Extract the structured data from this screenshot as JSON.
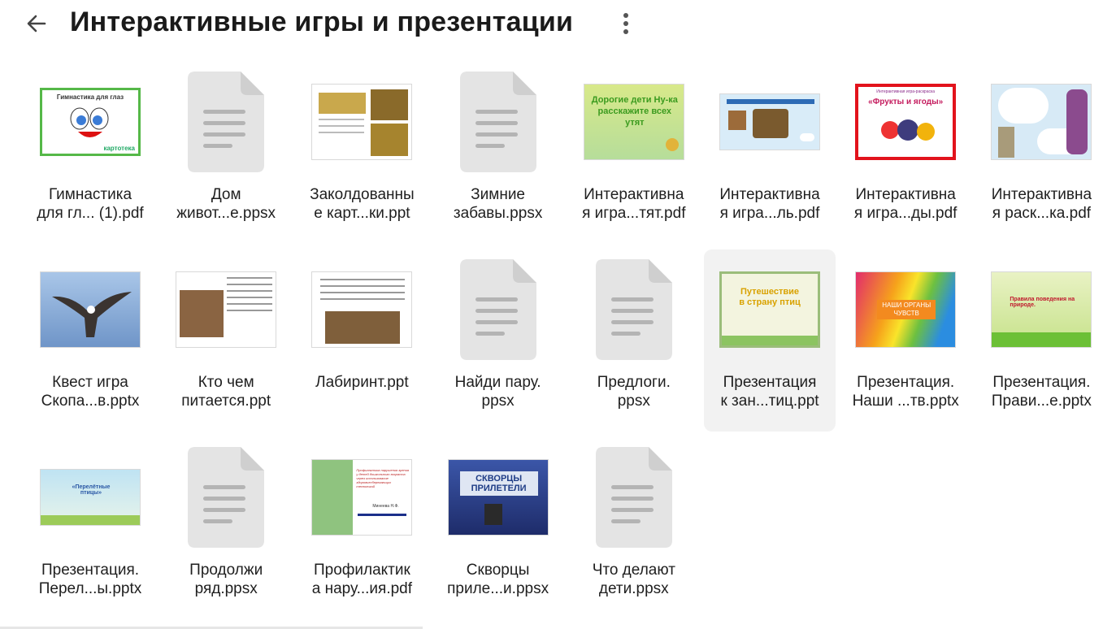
{
  "header": {
    "title": "Интерактивные игры и презентации",
    "back_icon": "arrow-left-icon",
    "menu_icon": "more-vertical-icon"
  },
  "files": [
    {
      "line1": "Гимнастика",
      "line2": "для гл... (1).pdf",
      "kind": "image",
      "preview": "gym"
    },
    {
      "line1": "Дом",
      "line2": "живот...е.ppsx",
      "kind": "doc"
    },
    {
      "line1": "Заколдованны",
      "line2": "е карт...ки.ppt",
      "kind": "image",
      "preview": "cards"
    },
    {
      "line1": "Зимние",
      "line2": "забавы.ppsx",
      "kind": "doc"
    },
    {
      "line1": "Интерактивна",
      "line2": "я игра...тят.pdf",
      "kind": "image",
      "preview": "green"
    },
    {
      "line1": "Интерактивна",
      "line2": "я игра...ль.pdf",
      "kind": "image",
      "preview": "kitchen"
    },
    {
      "line1": "Интерактивна",
      "line2": "я игра...ды.pdf",
      "kind": "image",
      "preview": "fruits"
    },
    {
      "line1": "Интерактивна",
      "line2": "я раск...ка.pdf",
      "kind": "image",
      "preview": "tale"
    },
    {
      "line1": "Квест игра",
      "line2": "Скопа...в.pptx",
      "kind": "image",
      "preview": "bird"
    },
    {
      "line1": "Кто чем",
      "line2": "питается.ppt",
      "kind": "image",
      "preview": "feed"
    },
    {
      "line1": "Лабиринт.ppt",
      "line2": "",
      "kind": "image",
      "preview": "maze"
    },
    {
      "line1": "Найди пару.",
      "line2": "ppsx",
      "kind": "doc"
    },
    {
      "line1": "Предлоги.",
      "line2": "ppsx",
      "kind": "doc"
    },
    {
      "line1": "Презентация",
      "line2": "к зан...тиц.ppt",
      "kind": "image",
      "preview": "travel",
      "selected": true
    },
    {
      "line1": "Презентация.",
      "line2": "Наши ...тв.pptx",
      "kind": "image",
      "preview": "senses"
    },
    {
      "line1": "Презентация.",
      "line2": "Прави...е.pptx",
      "kind": "image",
      "preview": "rules"
    },
    {
      "line1": "Презентация.",
      "line2": "Перел...ы.pptx",
      "kind": "image",
      "preview": "birds2"
    },
    {
      "line1": "Продолжи",
      "line2": "ряд.ppsx",
      "kind": "doc"
    },
    {
      "line1": "Профилактик",
      "line2": "а нару...ия.pdf",
      "kind": "image",
      "preview": "prof"
    },
    {
      "line1": "Скворцы",
      "line2": "приле...и.ppsx",
      "kind": "image",
      "preview": "starlings"
    },
    {
      "line1": "Что делают",
      "line2": "дети.ppsx",
      "kind": "doc"
    }
  ],
  "preview_text": {
    "gym_top": "Гимнастика для глаз",
    "gym_bottom": "картотека",
    "green": "Дорогие дети Ну-ка расскажите всех утят",
    "fruits": "«Фрукты и ягоды»",
    "fruits_top": "Интерактивная игра-раскраска",
    "travel": "Путешествие в страну птиц",
    "senses": "НАШИ ОРГАНЫ ЧУВСТВ",
    "rules": "Правила поведения на природе.",
    "birds2": "«Перелётные птицы»",
    "prof": "Профилактика нарушения зрения у детей дошкольного возраста через использование здоровьесберегающих технологий",
    "prof_author": "Минеева Н.Ф.",
    "starlings": "СКВОРЦЫ ПРИЛЕТЕЛИ"
  },
  "colors": {
    "doc_icon": "#e3e3e3",
    "doc_lines": "#b5b5b5",
    "selected_bg": "#f2f2f2",
    "text": "#1f1f1f"
  }
}
